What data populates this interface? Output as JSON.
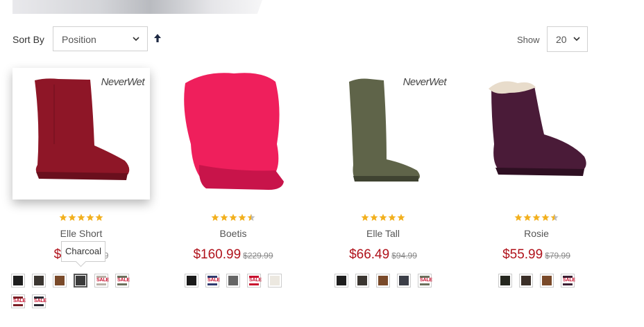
{
  "toolbar": {
    "sort_label": "Sort By",
    "sort_value": "Position",
    "sort_dir_icon": "arrow-up-icon",
    "show_label": "Show",
    "limit_value": "20"
  },
  "colors": {
    "price": "#b0121b",
    "star": "#f2b01e",
    "star_empty": "#bbbbbb"
  },
  "products": [
    {
      "name": "Elle Short",
      "price": "$5",
      "price_hidden": "$59.99",
      "old_price": "9",
      "rating": 5,
      "brand_badge": "NeverWet",
      "swatch_colors": [
        "#1e1e1e",
        "#3b3631",
        "#7a4a2a",
        "#3a3a3a",
        "sale:#b8b0a6",
        "sale:#6b705c",
        "sale:#7a1e24",
        "sale:#2a2a33"
      ],
      "selected_swatch": 3
    },
    {
      "name": "Boetis",
      "price": "$160.99",
      "old_price": "$229.99",
      "rating": 4.5,
      "brand_badge": "",
      "swatch_colors": [
        "#1a1a1a",
        "sale:#2e3a6e",
        "#666",
        "sale:#c8102e",
        "#ece8e0"
      ]
    },
    {
      "name": "Elle Tall",
      "price": "$66.49",
      "old_price": "$94.99",
      "rating": 5,
      "brand_badge": "NeverWet",
      "swatch_colors": [
        "#1e1e1e",
        "#3b3631",
        "#7a4a2a",
        "#3c3f48",
        "sale:#6b705c"
      ]
    },
    {
      "name": "Rosie",
      "price": "$55.99",
      "old_price": "$79.99",
      "rating": 4.5,
      "brand_badge": "",
      "swatch_colors": [
        "#25271f",
        "#3b2f28",
        "#7a4a2a",
        "sale:#3b1f33"
      ]
    }
  ],
  "sale_text": "SALE",
  "tooltip": {
    "text": "Charcoal"
  }
}
